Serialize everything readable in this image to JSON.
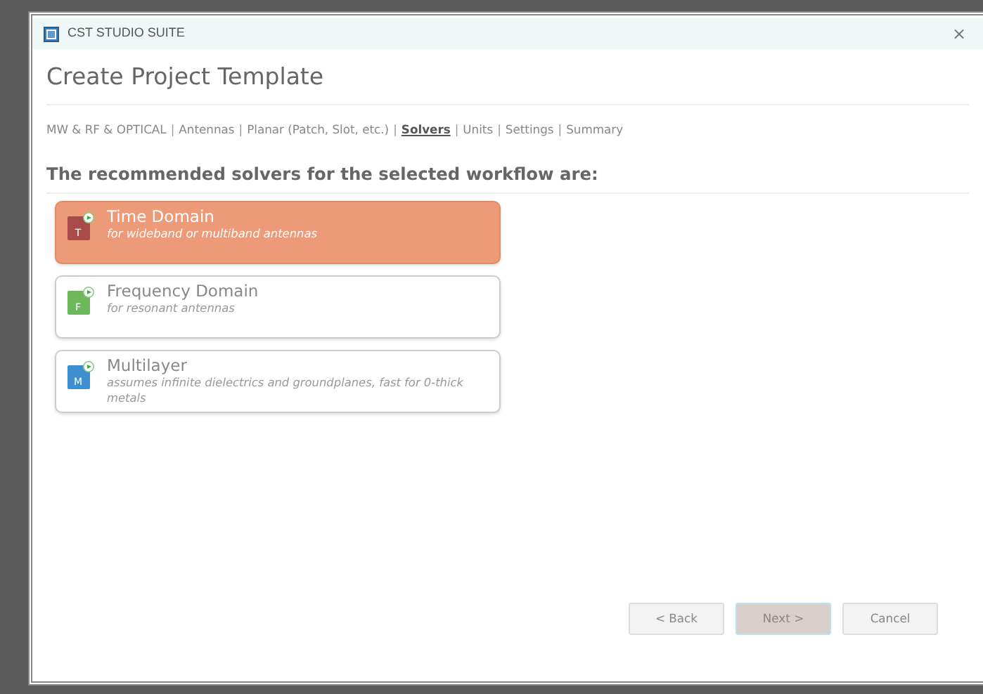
{
  "window": {
    "title": "CST STUDIO SUITE",
    "close": "×"
  },
  "heading": "Create Project Template",
  "breadcrumb_separator": "|",
  "breadcrumb": [
    {
      "label": "MW & RF & OPTICAL",
      "selected": false
    },
    {
      "label": "Antennas",
      "selected": false
    },
    {
      "label": "Planar (Patch, Slot, etc.)",
      "selected": false
    },
    {
      "label": "Solvers",
      "selected": true
    },
    {
      "label": "Units",
      "selected": false
    },
    {
      "label": "Settings",
      "selected": false
    },
    {
      "label": "Summary",
      "selected": false
    }
  ],
  "prompt": "The recommended solvers for the selected workflow are:",
  "solvers": [
    {
      "name": "Time Domain",
      "description": "for wideband or multiband antennas",
      "icon_letter": "T",
      "color": "#a84a4a",
      "selected": true
    },
    {
      "name": "Frequency Domain",
      "description": "for resonant antennas",
      "icon_letter": "F",
      "color": "#6cb85a",
      "selected": false
    },
    {
      "name": "Multilayer",
      "description": "assumes infinite dielectrics and groundplanes, fast for 0-thick metals",
      "icon_letter": "M",
      "color": "#3e8fd0",
      "selected": false
    }
  ],
  "buttons": [
    {
      "label": "< Back",
      "default": false
    },
    {
      "label": "Next >",
      "default": true
    },
    {
      "label": "Cancel",
      "default": false
    }
  ]
}
